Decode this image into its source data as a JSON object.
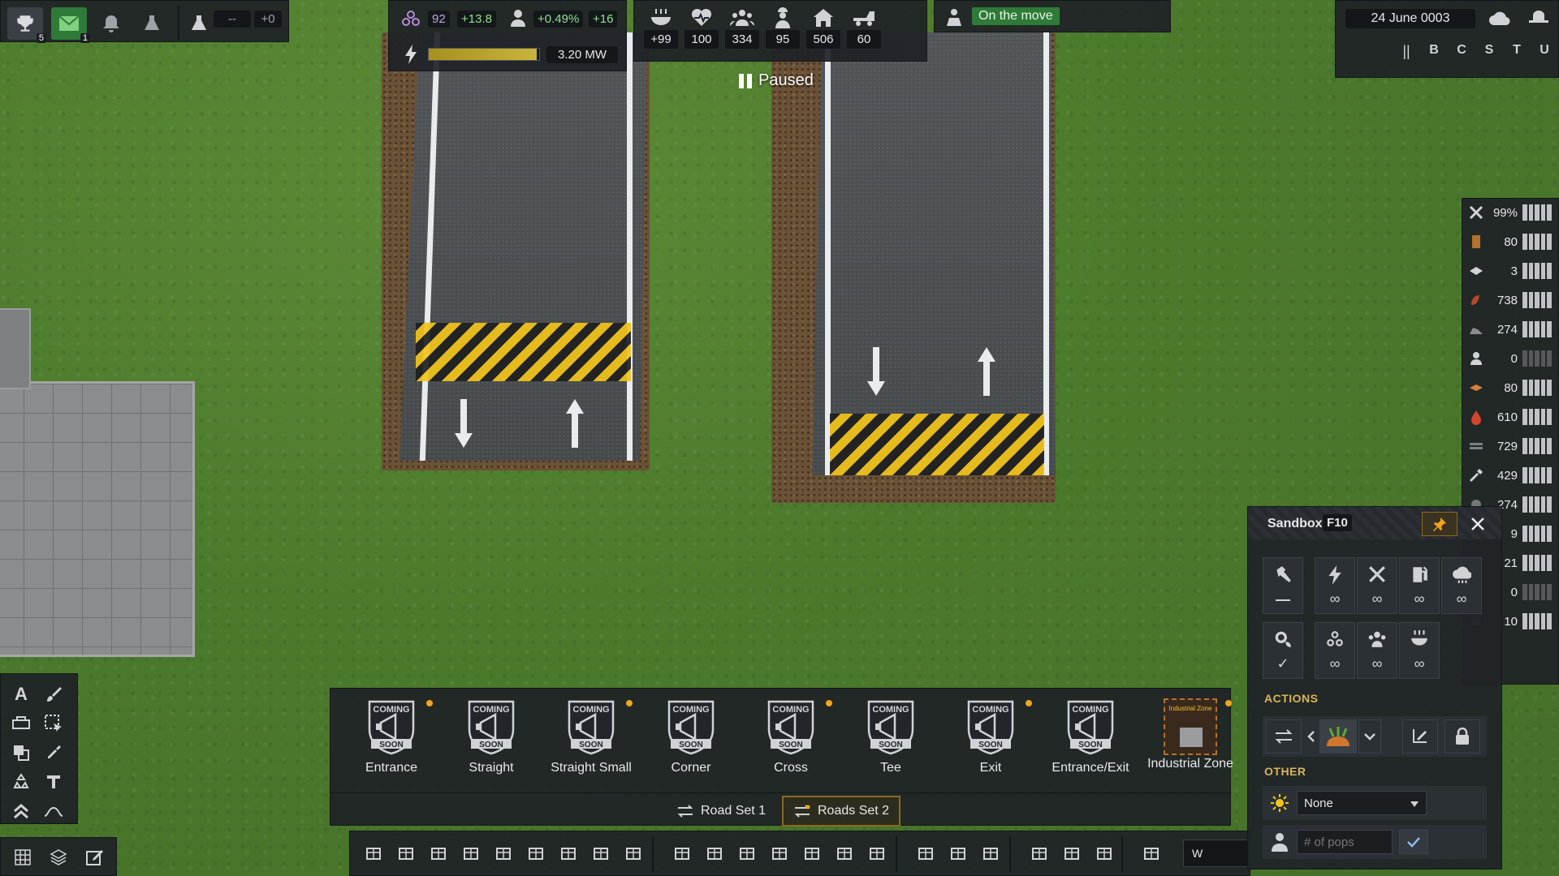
{
  "top_left": {
    "trophy_count": "5",
    "mail_count": "1",
    "research_value": "--",
    "research_delta": "+0"
  },
  "top_stats": {
    "unity": "92",
    "unity_delta": "+13.8",
    "pop_growth": "+0.49%",
    "pop_delta": "+16",
    "power_value": "3.20 MW",
    "power_fill": 0.98,
    "food": "+99",
    "health": "100",
    "population": "334",
    "workers": "95",
    "housing": "506",
    "vehicles": "60"
  },
  "status": {
    "label": "On the move",
    "paused": "Paused"
  },
  "date": {
    "label": "24 June 0003"
  },
  "speed_controls": [
    "||",
    "B",
    "C",
    "S",
    "T",
    "U"
  ],
  "resources": [
    {
      "icon": "maintenance-icon",
      "value": "99%",
      "full": true
    },
    {
      "icon": "wood-icon",
      "value": "80",
      "full": true
    },
    {
      "icon": "plank-icon",
      "value": "3",
      "full": true
    },
    {
      "icon": "food-icon",
      "value": "738",
      "full": true
    },
    {
      "icon": "rock-icon",
      "value": "274",
      "full": true
    },
    {
      "icon": "worker-icon",
      "value": "0",
      "full": false
    },
    {
      "icon": "brick-icon",
      "value": "80",
      "full": true
    },
    {
      "icon": "fuel-icon",
      "value": "610",
      "full": true
    },
    {
      "icon": "steel-icon",
      "value": "729",
      "full": true
    },
    {
      "icon": "wrench-icon",
      "value": "429",
      "full": true
    },
    {
      "icon": "unknown-icon",
      "value": "274",
      "full": true
    },
    {
      "icon": "unknown-icon",
      "value": "9",
      "full": true
    },
    {
      "icon": "unknown-icon",
      "value": "21",
      "full": true
    },
    {
      "icon": "unknown-icon",
      "value": "0",
      "full": false
    },
    {
      "icon": "unknown-icon",
      "value": "10",
      "full": true
    }
  ],
  "build_items": [
    {
      "label": "Entrance",
      "dot": true,
      "coming_soon": true
    },
    {
      "label": "Straight",
      "dot": false,
      "coming_soon": true
    },
    {
      "label": "Straight Small",
      "dot": true,
      "coming_soon": true
    },
    {
      "label": "Corner",
      "dot": false,
      "coming_soon": true
    },
    {
      "label": "Cross",
      "dot": true,
      "coming_soon": true
    },
    {
      "label": "Tee",
      "dot": false,
      "coming_soon": true
    },
    {
      "label": "Exit",
      "dot": true,
      "coming_soon": true
    },
    {
      "label": "Entrance/Exit",
      "dot": false,
      "coming_soon": true
    },
    {
      "label": "Industrial Zone",
      "dot": true,
      "coming_soon": false
    }
  ],
  "coming_soon_top": "COMING",
  "coming_soon_bottom": "SOON",
  "industrial_zone_thumb": "Industrial Zone",
  "tabs": [
    {
      "label": "Road Set 1",
      "active": false
    },
    {
      "label": "Roads Set 2",
      "active": true
    }
  ],
  "search": {
    "value": "W"
  },
  "sandbox": {
    "title": "Sandbox",
    "hotkey": "F10",
    "tiles_row1": [
      {
        "icon": "hammer-icon",
        "value": ""
      },
      {
        "icon": "lightning-icon",
        "value": "∞"
      },
      {
        "icon": "tools-icon",
        "value": "∞"
      },
      {
        "icon": "fuel-pump-icon",
        "value": "∞"
      },
      {
        "icon": "cloud-icon",
        "value": "∞"
      }
    ],
    "tiles_row2": [
      {
        "icon": "gear-plant-icon",
        "value": "✓"
      },
      {
        "icon": "unity-icon",
        "value": "∞"
      },
      {
        "icon": "people-icon",
        "value": "∞"
      },
      {
        "icon": "food-bowl-icon",
        "value": "∞"
      }
    ],
    "actions_label": "ACTIONS",
    "other_label": "OTHER",
    "weather_select": "None",
    "pops_placeholder": "# of pops"
  },
  "colors": {
    "accent": "#f2a51a",
    "green": "#2f7a38",
    "hazard_yellow": "#f2c419"
  }
}
